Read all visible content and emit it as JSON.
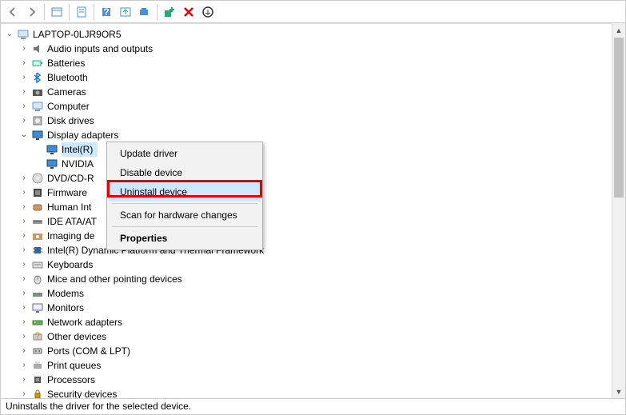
{
  "toolbar": {
    "icons": [
      "back",
      "forward",
      "show-hidden",
      "properties",
      "help",
      "update",
      "scan",
      "add-legacy",
      "remove",
      "more"
    ]
  },
  "tree": {
    "root": {
      "label": "LAPTOP-0LJR9OR5",
      "expanded": true,
      "icon": "computer"
    },
    "categories": [
      {
        "label": "Audio inputs and outputs",
        "icon": "audio",
        "expanded": false
      },
      {
        "label": "Batteries",
        "icon": "battery",
        "expanded": false
      },
      {
        "label": "Bluetooth",
        "icon": "bluetooth",
        "expanded": false
      },
      {
        "label": "Cameras",
        "icon": "camera",
        "expanded": false
      },
      {
        "label": "Computer",
        "icon": "computer",
        "expanded": false
      },
      {
        "label": "Disk drives",
        "icon": "disk",
        "expanded": false
      },
      {
        "label": "Display adapters",
        "icon": "display",
        "expanded": true,
        "children": [
          {
            "label": "Intel(R)",
            "icon": "display",
            "selected": true
          },
          {
            "label": "NVIDIA",
            "icon": "display"
          }
        ]
      },
      {
        "label": "DVD/CD-R",
        "icon": "dvd",
        "expanded": false,
        "truncated": true
      },
      {
        "label": "Firmware",
        "icon": "firmware",
        "expanded": false
      },
      {
        "label": "Human Int",
        "icon": "hid",
        "expanded": false,
        "truncated": true
      },
      {
        "label": "IDE ATA/AT",
        "icon": "ide",
        "expanded": false,
        "truncated": true
      },
      {
        "label": "Imaging de",
        "icon": "imaging",
        "expanded": false,
        "truncated": true
      },
      {
        "label": "Intel(R) Dynamic Platform and Thermal Framework",
        "icon": "chip",
        "expanded": false
      },
      {
        "label": "Keyboards",
        "icon": "keyboard",
        "expanded": false
      },
      {
        "label": "Mice and other pointing devices",
        "icon": "mouse",
        "expanded": false
      },
      {
        "label": "Modems",
        "icon": "modem",
        "expanded": false
      },
      {
        "label": "Monitors",
        "icon": "monitor",
        "expanded": false
      },
      {
        "label": "Network adapters",
        "icon": "network",
        "expanded": false
      },
      {
        "label": "Other devices",
        "icon": "other",
        "expanded": false
      },
      {
        "label": "Ports (COM & LPT)",
        "icon": "port",
        "expanded": false
      },
      {
        "label": "Print queues",
        "icon": "printer",
        "expanded": false
      },
      {
        "label": "Processors",
        "icon": "cpu",
        "expanded": false
      },
      {
        "label": "Security devices",
        "icon": "security",
        "expanded": false
      }
    ]
  },
  "context_menu": {
    "items": [
      {
        "label": "Update driver"
      },
      {
        "label": "Disable device"
      },
      {
        "label": "Uninstall device",
        "highlighted": true,
        "annotated": true
      },
      {
        "sep": true
      },
      {
        "label": "Scan for hardware changes"
      },
      {
        "sep": true
      },
      {
        "label": "Properties",
        "bold": true
      }
    ]
  },
  "status_bar": {
    "text": "Uninstalls the driver for the selected device."
  },
  "colors": {
    "selection": "#cde8ff",
    "annotation": "#e60000"
  }
}
